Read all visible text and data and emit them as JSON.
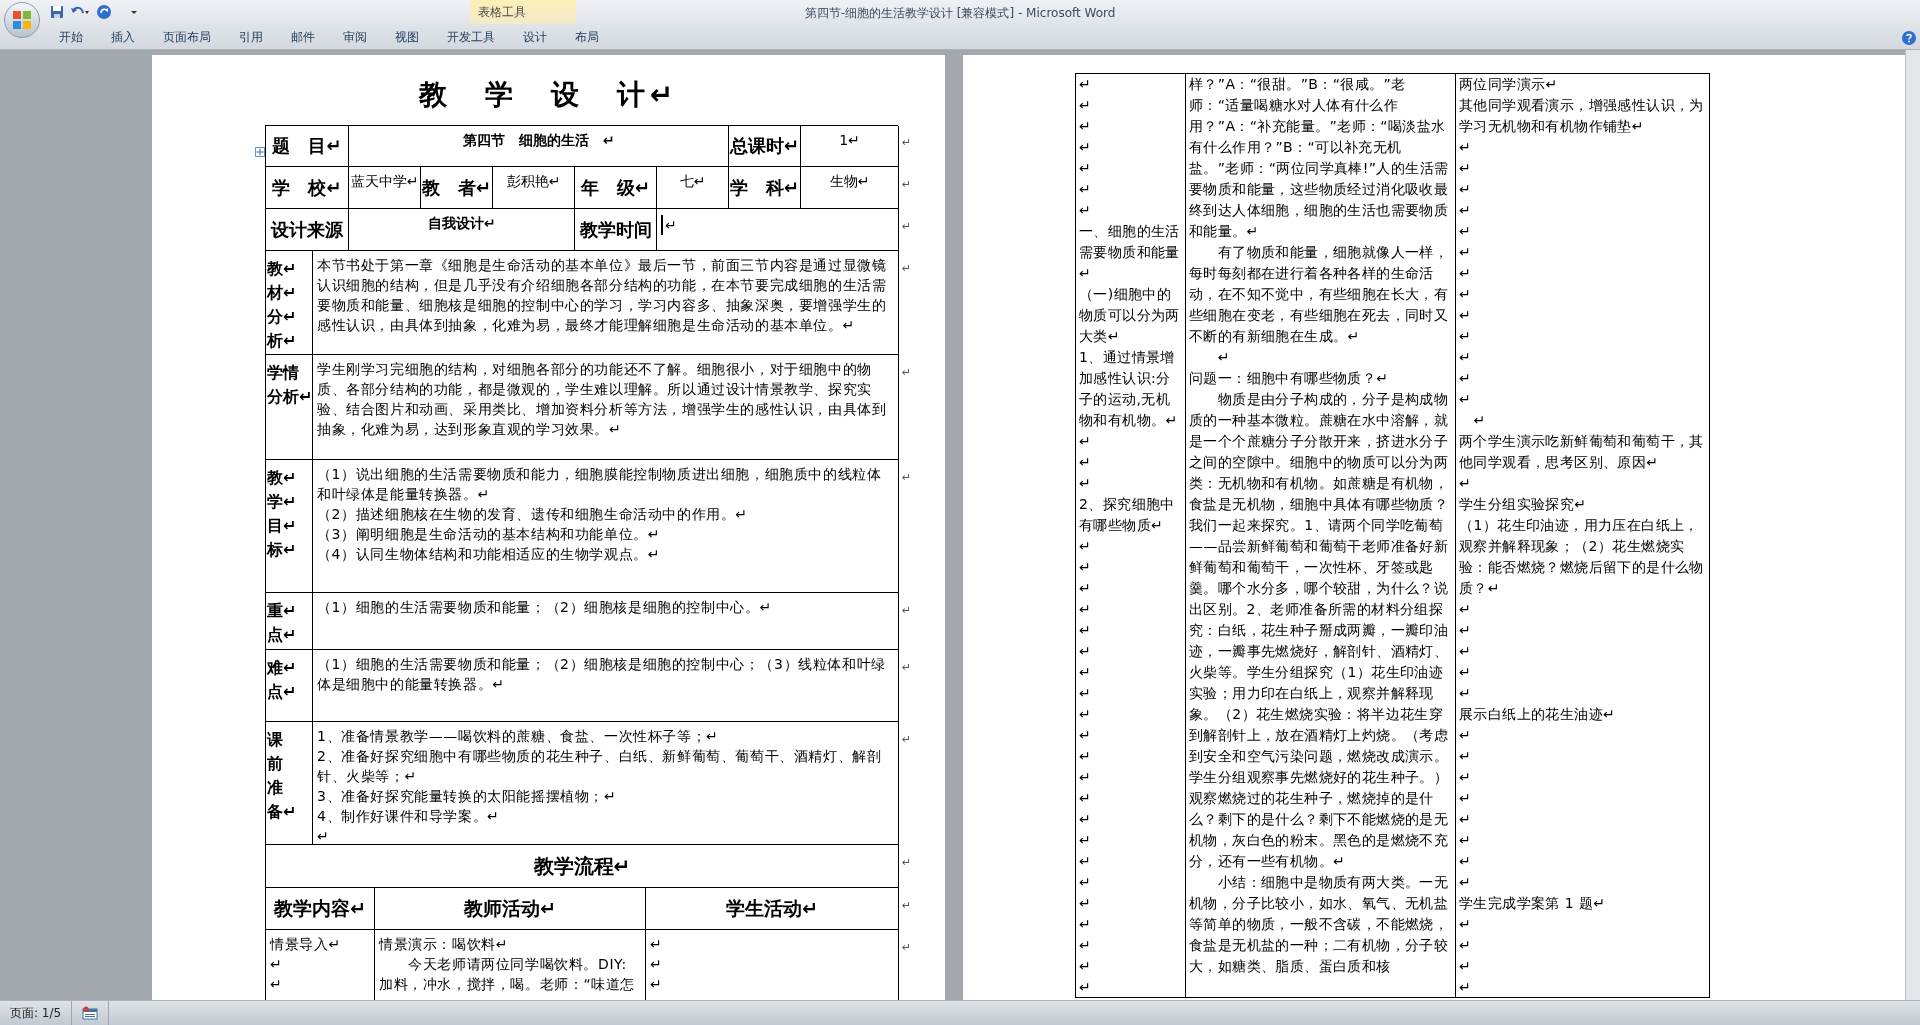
{
  "window": {
    "title": "第四节-细胞的生活教学设计 [兼容模式] - Microsoft Word"
  },
  "contextual_tab_group": {
    "label": "表格工具"
  },
  "ribbon_tabs": [
    {
      "label": "开始",
      "selected": false
    },
    {
      "label": "插入",
      "selected": false
    },
    {
      "label": "页面布局",
      "selected": false
    },
    {
      "label": "引用",
      "selected": false
    },
    {
      "label": "邮件",
      "selected": false
    },
    {
      "label": "审阅",
      "selected": false
    },
    {
      "label": "视图",
      "selected": false
    },
    {
      "label": "开发工具",
      "selected": false
    },
    {
      "label": "设计",
      "selected": false
    },
    {
      "label": "布局",
      "selected": false
    }
  ],
  "left_page": {
    "title": "教　学　设　计↵",
    "rows": [
      {
        "kind": "title_row",
        "end_mark": "↵",
        "cells": [
          {
            "text": "题　目↵",
            "bold": true
          },
          {
            "text": "第四节　细胞的生活　↵",
            "bold": true
          },
          {
            "text": "总课时↵",
            "bold": true
          },
          {
            "text": "1↵",
            "bold": false
          }
        ]
      },
      {
        "kind": "info_row",
        "end_mark": "↵",
        "cells": [
          {
            "text": "学　校↵",
            "bold": true
          },
          {
            "text": "蓝天中学↵",
            "bold": false
          },
          {
            "text": "教　者↵",
            "bold": true
          },
          {
            "text": "彭积艳↵",
            "bold": false
          },
          {
            "text": "年　级↵",
            "bold": true
          },
          {
            "text": "七↵",
            "bold": false
          },
          {
            "text": "学　科↵",
            "bold": true
          },
          {
            "text": "生物↵",
            "bold": false
          }
        ]
      },
      {
        "kind": "source_row",
        "end_mark": "↵",
        "cells": [
          {
            "text": "设计来源",
            "bold": true
          },
          {
            "text": "自我设计↵",
            "bold": true
          },
          {
            "text": "教学时间",
            "bold": true
          },
          {
            "text": "↵",
            "bold": false,
            "cursor": true
          }
        ]
      },
      {
        "kind": "section",
        "end_mark": "↵",
        "label": [
          "教↵",
          "材↵",
          "分↵",
          "析↵"
        ],
        "paragraphs": [
          "本节书处于第一章《细胞是生命活动的基本单位》最后一节，前面三节内容是通过显微镜认识细胞的结构，但是几乎没有介绍细胞各部分结构的功能，在本节要完成细胞的生活需要物质和能量、细胞核是细胞的控制中心的学习，学习内容多、抽象深奥，要增强学生的感性认识，由具体到抽象，化难为易，最终才能理解细胞是生命活动的基本单位。↵"
        ]
      },
      {
        "kind": "section",
        "end_mark": "↵",
        "label": [
          "学情",
          "分析↵"
        ],
        "paragraphs": [
          "学生刚学习完细胞的结构，对细胞各部分的功能还不了解。细胞很小，对于细胞中的物质、各部分结构的功能，都是微观的，学生难以理解。所以通过设计情景教学、探究实验、结合图片和动画、采用类比、增加资料分析等方法，增强学生的感性认识，由具体到抽象，化难为易，达到形象直观的学习效果。↵"
        ]
      },
      {
        "kind": "section",
        "end_mark": "↵",
        "label": [
          "教↵",
          "学↵",
          "目↵",
          "标↵"
        ],
        "paragraphs": [
          "（1）说出细胞的生活需要物质和能力，细胞膜能控制物质进出细胞，细胞质中的线粒体和叶绿体是能量转换器。↵",
          "（2）描述细胞核在生物的发育、遗传和细胞生命活动中的作用。↵",
          "（3）阐明细胞是生命活动的基本结构和功能单位。↵",
          "（4）认同生物体结构和功能相适应的生物学观点。↵"
        ]
      },
      {
        "kind": "section",
        "end_mark": "↵",
        "label": [
          "重↵",
          "点↵"
        ],
        "paragraphs": [
          "（1）细胞的生活需要物质和能量；（2）细胞核是细胞的控制中心。↵"
        ]
      },
      {
        "kind": "section",
        "end_mark": "↵",
        "label": [
          "难↵",
          "点↵"
        ],
        "paragraphs": [
          "（1）细胞的生活需要物质和能量；（2）细胞核是细胞的控制中心；（3）线粒体和叶绿体是细胞中的能量转换器。↵"
        ]
      },
      {
        "kind": "section",
        "end_mark": "↵",
        "label": [
          "课",
          "前",
          "准",
          "备↵"
        ],
        "paragraphs": [
          "1、准备情景教学——喝饮料的蔗糖、食盐、一次性杯子等；↵",
          "2、准备好探究细胞中有哪些物质的花生种子、白纸、新鲜葡萄、葡萄干、酒精灯、解剖针、火柴等；↵",
          "3、准备好探究能量转换的太阳能摇摆植物；↵",
          "4、制作好课件和导学案。↵",
          "↵"
        ]
      },
      {
        "kind": "heading",
        "end_mark": "↵",
        "text": "教学流程↵"
      },
      {
        "kind": "flow_header",
        "end_mark": "↵",
        "cells": [
          "教学内容↵",
          "教师活动↵",
          "学生活动↵"
        ]
      },
      {
        "kind": "flow_row",
        "end_mark": "↵",
        "columns": [
          [
            "情景导入↵",
            "↵",
            "↵"
          ],
          [
            "情景演示：喝饮料↵",
            "　　今天老师请两位同学喝饮料。DIY:加料，冲水，搅拌，喝。老师：“味道怎"
          ],
          [
            "↵",
            "↵",
            "↵"
          ]
        ]
      }
    ]
  },
  "right_page": {
    "columns": [
      [
        "↵",
        "↵",
        "↵",
        "↵",
        "↵",
        "↵",
        "↵",
        "一、细胞的生活需要物质和能量↵",
        "（一)细胞中的物质可以分为两大类↵",
        "1、通过情景增加感性认识:分子的运动,无机物和有机物。↵",
        "↵",
        "↵",
        "↵",
        "2、探究细胞中有哪些物质↵",
        "↵",
        "↵",
        "↵",
        "↵",
        "↵",
        "↵",
        "↵",
        "↵",
        "↵",
        "↵",
        "↵",
        "↵",
        "↵",
        "↵",
        "↵",
        "↵",
        "↵",
        "↵",
        "↵",
        "↵",
        "↵",
        "↵"
      ],
      [
        "样？”A：“很甜。”B：“很咸。”老师：“适量喝糖水对人体有什么作用？”A：“补充能量。”老师：“喝淡盐水有什么作用？”B：“可以补充无机盐。”老师：“两位同学真棒!”人的生活需要物质和能量，这些物质经过消化吸收最终到达人体细胞，细胞的生活也需要物质和能量。↵",
        "　　有了物质和能量，细胞就像人一样，每时每刻都在进行着各种各样的生命活动，在不知不觉中，有些细胞在长大，有些细胞在变老，有些细胞在死去，同时又不断的有新细胞在生成。↵",
        "　　↵",
        "问题一：细胞中有哪些物质？↵",
        "　　物质是由分子构成的，分子是构成物质的一种基本微粒。蔗糖在水中溶解，就是一个个蔗糖分子分散开来，挤进水分子之间的空隙中。细胞中的物质可以分为两类：无机物和有机物。如蔗糖是有机物，食盐是无机物，细胞中具体有哪些物质？我们一起来探究。1、请两个同学吃葡萄——品尝新鲜葡萄和葡萄干老师准备好新鲜葡萄和葡萄干，一次性杯、牙签或匙羹。哪个水分多，哪个较甜，为什么？说出区别。2、老师准备所需的材料分组探究：白纸，花生种子掰成两瓣，一瓣印油迹，一瓣事先燃烧好，解剖针、酒精灯、火柴等。学生分组探究（1）花生印油迹实验；用力印在白纸上，观察并解释现象。（2）花生燃烧实验：将半边花生穿到解剖针上，放在酒精灯上灼烧。（考虑到安全和空气污染问题，燃烧改成演示。学生分组观察事先燃烧好的花生种子。）观察燃烧过的花生种子，燃烧掉的是什么？剩下的是什么？剩下不能燃烧的是无机物，灰白色的粉末。黑色的是燃烧不充分，还有一些有机物。↵",
        "　　小结：细胞中是物质有两大类。一无机物，分子比较小，如水、氧气、无机盐等简单的物质，一般不含碳，不能燃烧，食盐是无机盐的一种；二有机物，分子较大，如糖类、脂质、蛋白质和核"
      ],
      [
        "两位同学演示↵",
        "其他同学观看演示，增强感性认识，为学习无机物和有机物作铺垫↵",
        "↵",
        "↵",
        "↵",
        "↵",
        "↵",
        "↵",
        "↵",
        "↵",
        "↵",
        "↵",
        "↵",
        "↵",
        "↵",
        "　↵",
        "两个学生演示吃新鲜葡萄和葡萄干，其他同学观看，思考区别、原因↵",
        "↵",
        "学生分组实验探究↵",
        "（1）花生印油迹，用力压在白纸上，观察并解释现象；（2）花生燃烧实验：能否燃烧？燃烧后留下的是什么物质？↵",
        "↵",
        "↵",
        "↵",
        "↵",
        "↵",
        "展示白纸上的花生油迹↵",
        "↵",
        "↵",
        "↵",
        "↵",
        "↵",
        "↵",
        "↵",
        "↵",
        "学生完成学案第 1 题↵",
        "↵",
        "↵",
        "↵",
        "↵"
      ]
    ]
  },
  "status_bar": {
    "page": "页面: 1/5"
  }
}
